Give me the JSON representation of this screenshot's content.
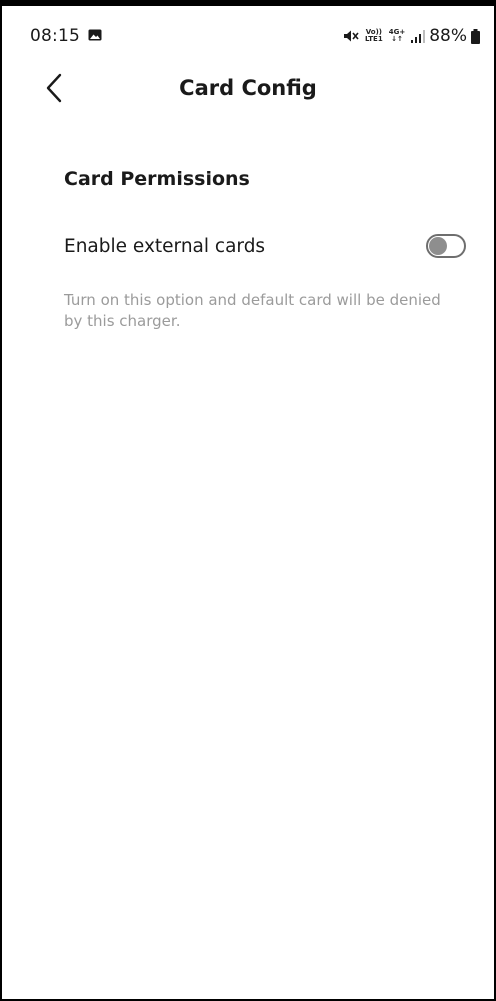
{
  "status_bar": {
    "time": "08:15",
    "network_line1": "Vo))",
    "network_line2": "LTE1",
    "network_type_top": "4G+",
    "network_type_bottom": "↓↑",
    "battery_percent": "88%",
    "icons": [
      "gallery-icon",
      "mute-icon",
      "signal-icon",
      "battery-icon"
    ]
  },
  "header": {
    "title": "Card Config",
    "back_icon": "chevron-left-icon"
  },
  "section": {
    "title": "Card Permissions",
    "option": {
      "label": "Enable external cards",
      "enabled": false
    },
    "help_text": "Turn on this option and default card will be denied by this charger."
  },
  "colors": {
    "background": "#ffffff",
    "text_primary": "#1a1a1a",
    "text_secondary": "#9b9b9b",
    "toggle_off_knob": "#8e8e8e",
    "toggle_off_border": "#6e6e6e"
  }
}
